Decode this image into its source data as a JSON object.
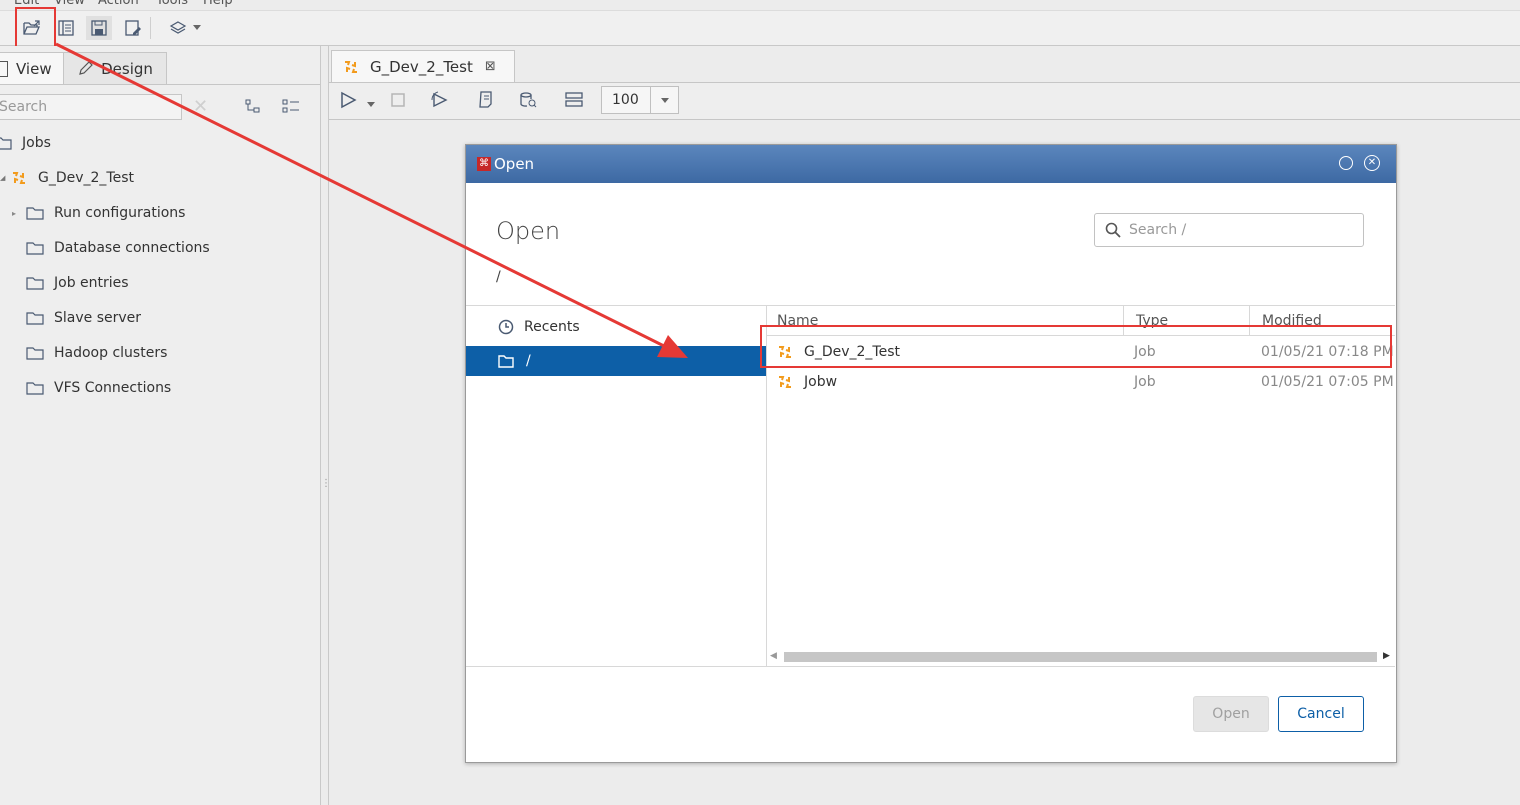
{
  "menu": [
    "Edit",
    "View",
    "Action",
    "Tools",
    "Help"
  ],
  "toolbar": {
    "icons": [
      "open-file-icon",
      "explore-icon",
      "save-icon",
      "save-as-icon",
      "layers-icon",
      "chevron-down-icon"
    ]
  },
  "left_panel": {
    "tabs": [
      {
        "label": "View"
      },
      {
        "label": "Design"
      }
    ],
    "search_placeholder": "Search",
    "tree": [
      {
        "label": "Jobs"
      },
      {
        "label": "G_Dev_2_Test"
      },
      {
        "label": "Run configurations"
      },
      {
        "label": "Database connections"
      },
      {
        "label": "Job entries"
      },
      {
        "label": "Slave server"
      },
      {
        "label": "Hadoop clusters"
      },
      {
        "label": "VFS Connections"
      }
    ]
  },
  "editor": {
    "tab_label": "G_Dev_2_Test",
    "zoom": "100"
  },
  "dialog": {
    "window_title": "Open",
    "heading": "Open",
    "path": "/",
    "search_placeholder": "Search /",
    "nav": [
      {
        "label": "Recents"
      },
      {
        "label": "/"
      }
    ],
    "columns": {
      "name": "Name",
      "type": "Type",
      "modified": "Modified"
    },
    "files": [
      {
        "name": "G_Dev_2_Test",
        "type": "Job",
        "modified": "01/05/21 07:18 PM"
      },
      {
        "name": "Jobw",
        "type": "Job",
        "modified": "01/05/21 07:05 PM"
      }
    ],
    "open_label": "Open",
    "cancel_label": "Cancel"
  },
  "colors": {
    "accent": "#0d5fa7",
    "annotation": "#e53935",
    "job_icon": "#f29b1d",
    "title_bar": "#4a75ae"
  }
}
